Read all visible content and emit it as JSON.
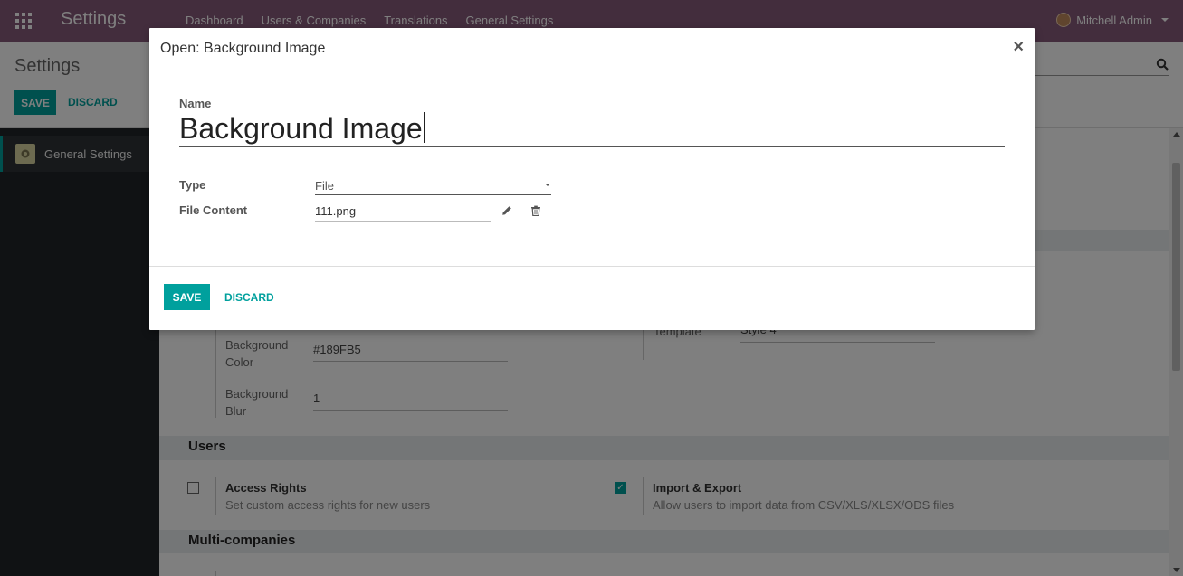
{
  "app": {
    "title": "Settings",
    "nav": [
      "Dashboard",
      "Users & Companies",
      "Translations",
      "General Settings"
    ],
    "user_name": "Mitchell Admin"
  },
  "control_panel": {
    "breadcrumb": "Settings",
    "save_label": "SAVE",
    "discard_label": "DISCARD"
  },
  "sidebar": {
    "items": [
      {
        "label": "General Settings",
        "icon": "gear-icon"
      }
    ]
  },
  "background_form": {
    "bg_color_label_1": "Background",
    "bg_color_label_2": "Color",
    "bg_color_value": "#189FB5",
    "bg_blur_label_1": "Background",
    "bg_blur_label_2": "Blur",
    "bg_blur_value": "1",
    "template_label": "Template",
    "template_value": "Style 4"
  },
  "users_section": {
    "title": "Users",
    "access_rights_title": "Access Rights",
    "access_rights_desc": "Set custom access rights for new users",
    "access_rights_checked": false,
    "import_export_title": "Import & Export",
    "import_export_desc": "Allow users to import data from CSV/XLS/XLSX/ODS files",
    "import_export_checked": true
  },
  "multi_companies": {
    "title": "Multi-companies"
  },
  "dialog": {
    "title": "Open: Background Image",
    "close_glyph": "×",
    "name_label": "Name",
    "name_value": "Background Image",
    "type_label": "Type",
    "type_value": "File",
    "file_content_label": "File Content",
    "file_value": "111.png",
    "save_label": "SAVE",
    "discard_label": "DISCARD"
  },
  "colors": {
    "brand": "#875a7b",
    "accent": "#00a09d",
    "sidebar": "#212529"
  }
}
